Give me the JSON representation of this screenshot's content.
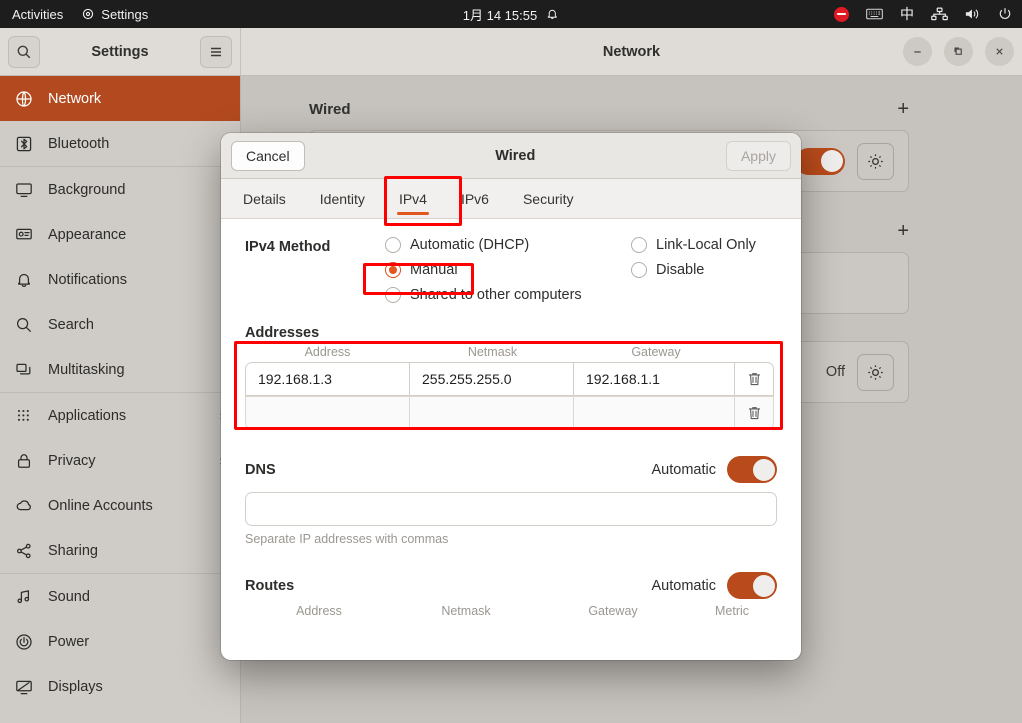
{
  "topbar": {
    "activities": "Activities",
    "app_menu": "Settings",
    "clock": "1月 14 15:55",
    "icons": {
      "app": "settings-gear-icon",
      "bell": "bell-icon",
      "dnd": "do-not-disturb-icon",
      "keyboard": "keyboard-icon",
      "ime": "中",
      "network": "network-wired-icon",
      "volume": "volume-icon",
      "power": "power-icon"
    }
  },
  "window": {
    "sidebar_title": "Settings",
    "page_title": "Network",
    "search_icon": "search-icon",
    "menu_icon": "hamburger-menu-icon",
    "controls": {
      "minimize": "—",
      "maximize": "❐",
      "close": "✕"
    }
  },
  "sidebar": {
    "items": [
      {
        "label": "Network",
        "icon": "globe-icon",
        "selected": true,
        "chevron": false
      },
      {
        "label": "Bluetooth",
        "icon": "bluetooth-icon",
        "selected": false,
        "chevron": false
      },
      {
        "label": "Background",
        "icon": "background-icon",
        "selected": false,
        "chevron": false
      },
      {
        "label": "Appearance",
        "icon": "appearance-icon",
        "selected": false,
        "chevron": false
      },
      {
        "label": "Notifications",
        "icon": "bell-icon",
        "selected": false,
        "chevron": false
      },
      {
        "label": "Search",
        "icon": "search-icon",
        "selected": false,
        "chevron": false
      },
      {
        "label": "Multitasking",
        "icon": "multitasking-icon",
        "selected": false,
        "chevron": false
      },
      {
        "label": "Applications",
        "icon": "apps-grid-icon",
        "selected": false,
        "chevron": true
      },
      {
        "label": "Privacy",
        "icon": "lock-icon",
        "selected": false,
        "chevron": true
      },
      {
        "label": "Online Accounts",
        "icon": "cloud-icon",
        "selected": false,
        "chevron": false
      },
      {
        "label": "Sharing",
        "icon": "share-icon",
        "selected": false,
        "chevron": false
      },
      {
        "label": "Sound",
        "icon": "sound-note-icon",
        "selected": false,
        "chevron": false
      },
      {
        "label": "Power",
        "icon": "power-icon",
        "selected": false,
        "chevron": false
      },
      {
        "label": "Displays",
        "icon": "display-icon",
        "selected": false,
        "chevron": false
      }
    ]
  },
  "network_page": {
    "wired_section_title": "Wired",
    "add_icon": "plus-icon",
    "gear_icon": "gear-icon",
    "wired_enabled": true,
    "vpn_off_label": "Off"
  },
  "dialog": {
    "cancel_label": "Cancel",
    "title": "Wired",
    "apply_label": "Apply",
    "apply_enabled": false,
    "tabs": [
      {
        "label": "Details",
        "active": false
      },
      {
        "label": "Identity",
        "active": false
      },
      {
        "label": "IPv4",
        "active": true
      },
      {
        "label": "IPv6",
        "active": false
      },
      {
        "label": "Security",
        "active": false
      }
    ],
    "ipv4_method": {
      "label": "IPv4 Method",
      "options_left": [
        {
          "label": "Automatic (DHCP)",
          "selected": false
        },
        {
          "label": "Manual",
          "selected": true
        },
        {
          "label": "Shared to other computers",
          "selected": false
        }
      ],
      "options_right": [
        {
          "label": "Link-Local Only",
          "selected": false
        },
        {
          "label": "Disable",
          "selected": false
        }
      ]
    },
    "addresses": {
      "title": "Addresses",
      "columns": [
        "Address",
        "Netmask",
        "Gateway"
      ],
      "rows": [
        {
          "address": "192.168.1.3",
          "netmask": "255.255.255.0",
          "gateway": "192.168.1.1"
        },
        {
          "address": "",
          "netmask": "",
          "gateway": ""
        }
      ],
      "delete_icon": "trash-icon"
    },
    "dns": {
      "title": "DNS",
      "automatic_label": "Automatic",
      "automatic_on": true,
      "value": "",
      "hint": "Separate IP addresses with commas"
    },
    "routes": {
      "title": "Routes",
      "automatic_label": "Automatic",
      "automatic_on": true,
      "columns": [
        "Address",
        "Netmask",
        "Gateway",
        "Metric"
      ]
    }
  },
  "annotations": {
    "color": "#ff0000",
    "boxes": [
      "ipv4-tab",
      "manual-radio",
      "addresses-section"
    ]
  }
}
